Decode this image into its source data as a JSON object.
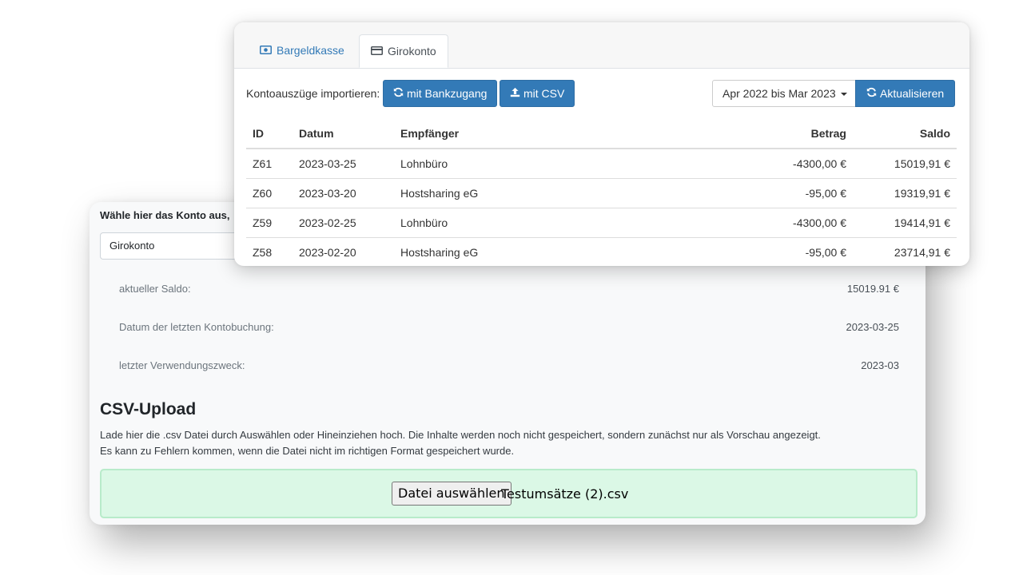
{
  "account_panel": {
    "select_label": "Wähle hier das Konto aus,",
    "selected_account": "Girokonto",
    "info": [
      {
        "label": "aktueller Saldo:",
        "value": "15019.91 €"
      },
      {
        "label": "Datum der letzten Kontobuchung:",
        "value": "2023-03-25"
      },
      {
        "label": "letzter Verwendungszweck:",
        "value": "2023-03"
      }
    ],
    "csv_title": "CSV-Upload",
    "csv_desc_1": "Lade hier die .csv Datei durch Auswählen oder Hineinziehen hoch. Die Inhalte werden noch nicht gespeichert, sondern zunächst nur als Vorschau angezeigt.",
    "csv_desc_2": "Es kann zu Fehlern kommen, wenn die Datei nicht im richtigen Format gespeichert wurde.",
    "file_button": "Datei auswählen",
    "file_name": "Testumsätze (2).csv"
  },
  "statements": {
    "tabs": [
      {
        "label": "Bargeldkasse",
        "icon": "cash-icon",
        "active": false
      },
      {
        "label": "Girokonto",
        "icon": "credit-card-icon",
        "active": true
      }
    ],
    "import_label": "Kontoauszüge importieren:",
    "bank_button": "mit Bankzugang",
    "csv_button": "mit CSV",
    "date_range": "Apr 2022 bis Mar 2023",
    "refresh_button": "Aktualisieren",
    "columns": [
      "ID",
      "Datum",
      "Empfänger",
      "Betrag",
      "Saldo"
    ],
    "rows": [
      {
        "id": "Z61",
        "date": "2023-03-25",
        "recipient": "Lohnbüro",
        "amount": "-4300,00  €",
        "balance": "15019,91  €"
      },
      {
        "id": "Z60",
        "date": "2023-03-20",
        "recipient": "Hostsharing eG",
        "amount": "-95,00  €",
        "balance": "19319,91  €"
      },
      {
        "id": "Z59",
        "date": "2023-02-25",
        "recipient": "Lohnbüro",
        "amount": "-4300,00  €",
        "balance": "19414,91  €"
      },
      {
        "id": "Z58",
        "date": "2023-02-20",
        "recipient": "Hostsharing eG",
        "amount": "-95,00  €",
        "balance": "23714,91  €"
      }
    ]
  },
  "colors": {
    "primary": "#337ab7",
    "dropzone_bg": "#dbf8e6",
    "panel_bg": "#f8f9fa"
  }
}
